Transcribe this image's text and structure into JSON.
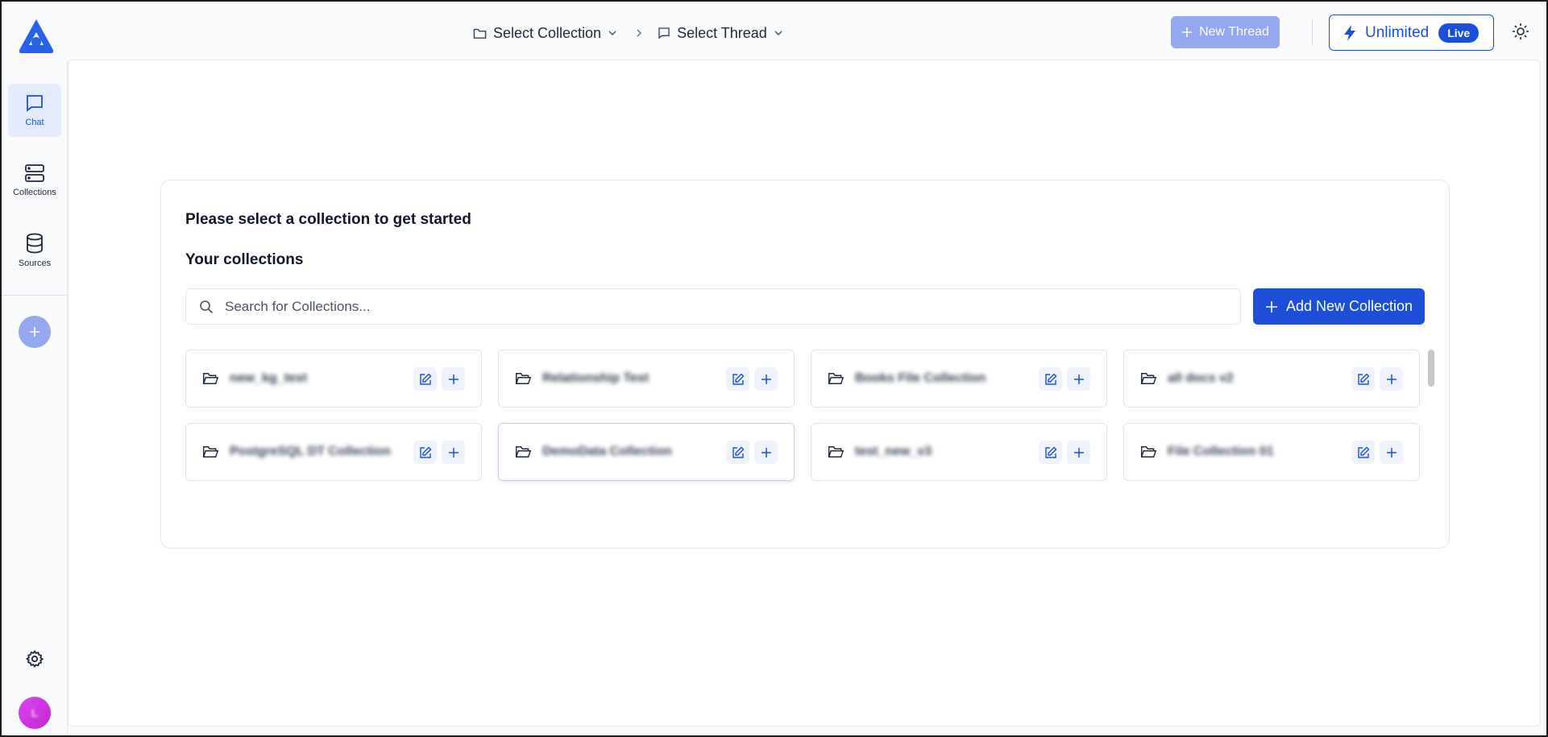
{
  "header": {
    "breadcrumb": {
      "collection_label": "Select Collection",
      "thread_label": "Select Thread"
    },
    "new_thread_label": "New Thread",
    "plan_label": "Unlimited",
    "plan_badge": "Live",
    "icons": [
      "app-logo",
      "folder-icon",
      "chevron-down-icon",
      "chevron-right-icon",
      "message-icon",
      "plus-icon",
      "lightning-icon",
      "sun-icon"
    ]
  },
  "sidebar": {
    "items": [
      {
        "label": "Chat",
        "icon": "message-icon",
        "active": true
      },
      {
        "label": "Collections",
        "icon": "server-icon",
        "active": false
      },
      {
        "label": "Sources",
        "icon": "database-icon",
        "active": false
      }
    ],
    "avatar_initial": "L"
  },
  "main": {
    "title": "Please select a collection to get started",
    "subtitle": "Your collections",
    "search_placeholder": "Search for Collections...",
    "add_button_label": "Add New Collection",
    "collections": [
      {
        "name": "new_kg_test"
      },
      {
        "name": "Relationship Test"
      },
      {
        "name": "Books File Collection"
      },
      {
        "name": "all docs v2"
      },
      {
        "name": "PostgreSQL DT Collection"
      },
      {
        "name": "DemoData Collection"
      },
      {
        "name": "test_new_v3"
      },
      {
        "name": "File Collection 01"
      }
    ]
  },
  "colors": {
    "accent": "#1d4ed8",
    "accent_light": "#93a8ee",
    "active_nav_bg": "#e3ebfc",
    "avatar": "#d946ef"
  }
}
